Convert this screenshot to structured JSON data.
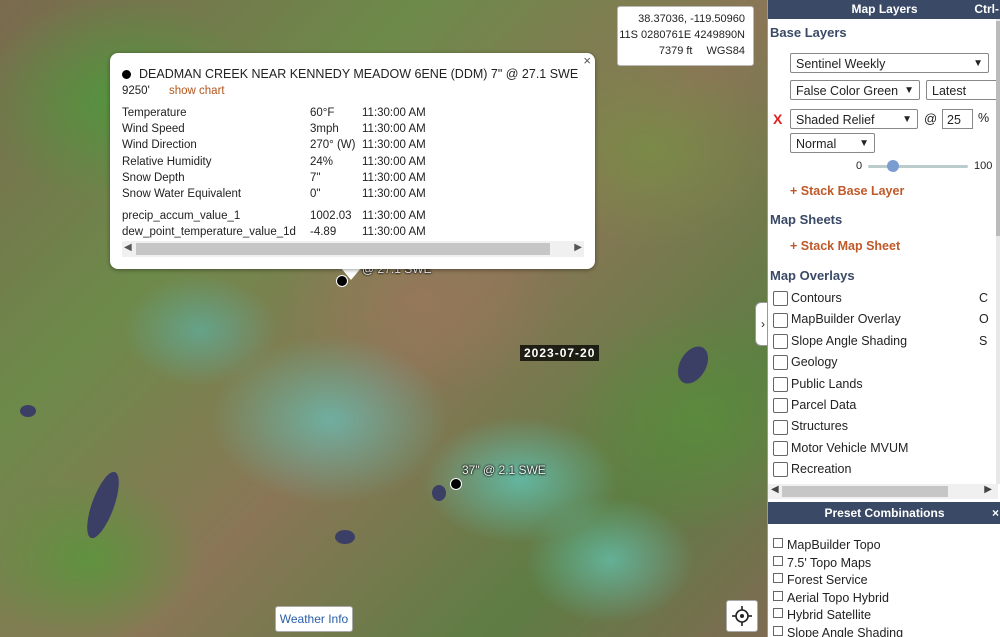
{
  "map": {
    "coords": {
      "latlon": "38.37036, -119.50960",
      "utm": "11S 0280761E 4249890N",
      "elevation": "7379 ft",
      "datum": "WGS84"
    },
    "date_badge": "2023-07-20",
    "station_label_1": "@ 27.1 SWE",
    "station_label_2": "37\" @ 2.1 SWE",
    "weather_button": "Weather Info",
    "collapse_arrow": "›",
    "popup": {
      "close": "×",
      "title": "DEADMAN CREEK NEAR KENNEDY MEADOW 6ENE (DDM) 7\" @ 27.1 SWE",
      "elevation": "9250'",
      "show_chart": "show chart",
      "rows": [
        {
          "name": "Temperature",
          "value": "60°F",
          "time": "11:30:00 AM"
        },
        {
          "name": "Wind Speed",
          "value": "3mph",
          "time": "11:30:00 AM"
        },
        {
          "name": "Wind Direction",
          "value": "270° (W)",
          "time": "11:30:00 AM"
        },
        {
          "name": "Relative Humidity",
          "value": "24%",
          "time": "11:30:00 AM"
        },
        {
          "name": "Snow Depth",
          "value": "7\"",
          "time": "11:30:00 AM"
        },
        {
          "name": "Snow Water Equivalent",
          "value": "0\"",
          "time": "11:30:00 AM"
        }
      ],
      "extra_rows": [
        {
          "name": "precip_accum_value_1",
          "value": "1002.03",
          "time": "11:30:00 AM"
        },
        {
          "name": "dew_point_temperature_value_1d",
          "value": "-4.89",
          "time": "11:30:00 AM"
        }
      ],
      "scroll_left": "◀",
      "scroll_right": "▶"
    }
  },
  "panel": {
    "header": "Map Layers",
    "header_shortcut": "Ctrl-",
    "base_layers": {
      "title": "Base Layers",
      "layer1": "Sentinel Weekly",
      "layer1_variant": "False Color Green",
      "layer1_date": "Latest",
      "remove_label": "X",
      "layer2": "Shaded Relief",
      "at": "@",
      "opacity": "25",
      "percent": "%",
      "blend": "Normal",
      "slider_min": "0",
      "slider_max": "100",
      "slider_value": 0.25,
      "stack_link": "+ Stack Base Layer"
    },
    "map_sheets": {
      "title": "Map Sheets",
      "stack_link": "+ Stack Map Sheet"
    },
    "overlays": {
      "title": "Map Overlays",
      "items": [
        {
          "label": "Contours",
          "shortcut": "C"
        },
        {
          "label": "MapBuilder Overlay",
          "shortcut": "O"
        },
        {
          "label": "Slope Angle Shading",
          "shortcut": "S"
        },
        {
          "label": "Geology",
          "shortcut": ""
        },
        {
          "label": "Public Lands",
          "shortcut": ""
        },
        {
          "label": "Parcel Data",
          "shortcut": ""
        },
        {
          "label": "Structures",
          "shortcut": ""
        },
        {
          "label": "Motor Vehicle MVUM",
          "shortcut": ""
        },
        {
          "label": "Recreation",
          "shortcut": ""
        }
      ]
    },
    "scroll_left": "◀",
    "scroll_right": "▶",
    "presets": {
      "header": "Preset Combinations",
      "close": "×",
      "items": [
        "MapBuilder Topo",
        "7.5' Topo Maps",
        "Forest Service",
        "Aerial Topo Hybrid",
        "Hybrid Satellite",
        "Slope Angle Shading"
      ]
    }
  }
}
